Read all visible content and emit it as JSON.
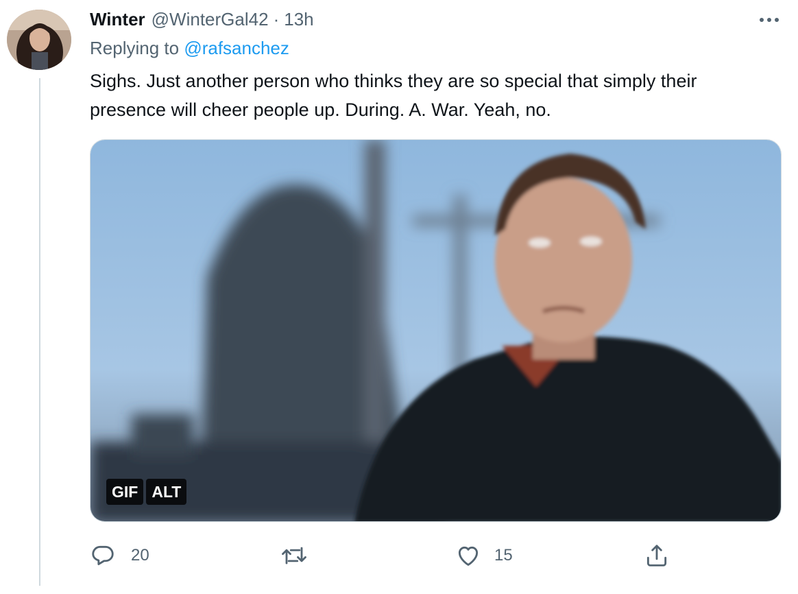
{
  "tweet": {
    "display_name": "Winter",
    "handle": "@WinterGal42",
    "separator": "·",
    "time": "13h",
    "replying_prefix": "Replying to",
    "replying_to": "@rafsanchez",
    "text": "Sighs. Just another person who thinks they are so special that simply their presence will cheer people up. During. A. War. Yeah, no.",
    "media": {
      "badges": [
        "GIF",
        "ALT"
      ]
    },
    "actions": {
      "reply": {
        "icon": "reply-icon",
        "count": "20"
      },
      "retweet": {
        "icon": "retweet-icon",
        "count": ""
      },
      "like": {
        "icon": "heart-icon",
        "count": "15"
      },
      "share": {
        "icon": "share-icon",
        "count": ""
      }
    }
  },
  "colors": {
    "text": "#0f1419",
    "secondary": "#536471",
    "link": "#1d9bf0",
    "border": "#cfd9de"
  }
}
